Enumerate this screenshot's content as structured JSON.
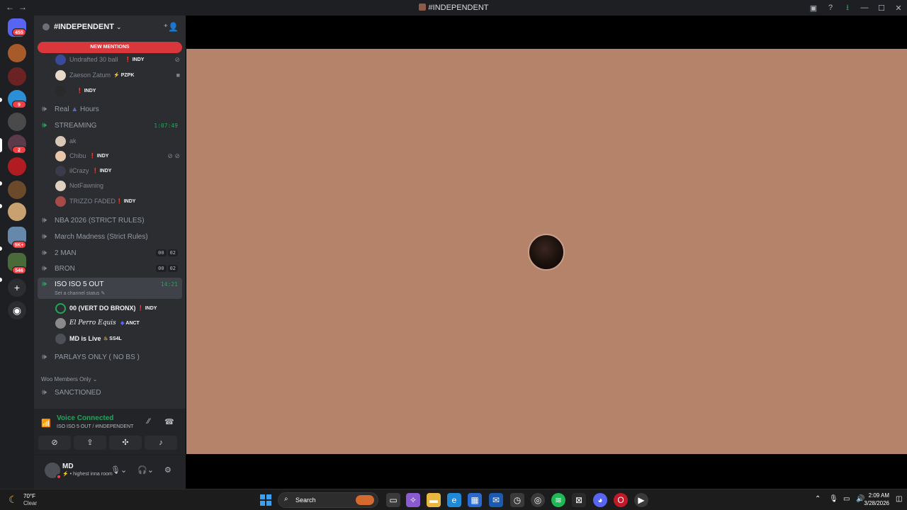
{
  "window": {
    "title": "#INDEPENDENT",
    "nav_back": "←",
    "nav_forward": "→",
    "icons": [
      "screen-icon",
      "help-icon",
      "download-icon"
    ]
  },
  "servers": {
    "home_badge": "455",
    "badges": [
      {
        "id": "s4",
        "count": "9"
      },
      {
        "id": "s6",
        "count": "2"
      },
      {
        "id": "s11",
        "count": "9K+"
      },
      {
        "id": "s12",
        "count": "546"
      }
    ]
  },
  "guild": {
    "name": "#INDEPENDENT",
    "new_mentions": "NEW MENTIONS"
  },
  "top_users": [
    {
      "name": "Undrafted 30 ball",
      "tag": "INDY"
    },
    {
      "name": "Zaeson Zatum",
      "tag": "PZPK"
    },
    {
      "name": "",
      "tag": "INDY"
    }
  ],
  "channels": {
    "real_hours": {
      "name": "Real",
      "name2": "Hours"
    },
    "streaming": {
      "name": "STREAMING",
      "timer": "1:07:49"
    },
    "streaming_users": [
      {
        "name": "ak",
        "tag": ""
      },
      {
        "name": "Chibu",
        "tag": "INDY"
      },
      {
        "name": "ilCrazy",
        "tag": "INDY"
      },
      {
        "name": "NotFawning",
        "tag": ""
      },
      {
        "name": "TRIZZO FADED",
        "tag": "INDY"
      }
    ],
    "nba": {
      "name": "NBA 2026 (STRICT RULES)"
    },
    "march": {
      "name": "March Madness (Strict Rules)"
    },
    "two_man": {
      "name": "2 MAN",
      "c1": "00",
      "c2": "02"
    },
    "bron": {
      "name": "BRON",
      "c1": "00",
      "c2": "02"
    },
    "iso": {
      "name": "ISO ISO 5 OUT",
      "timer": "14:21",
      "status": "Set a channel status"
    },
    "iso_users": [
      {
        "name": "00 (VERT DO BRONX)",
        "tag": "INDY"
      },
      {
        "name": "El Perro Equis",
        "tag": "ANCT"
      },
      {
        "name": "MD is Live",
        "tag": "SS4L"
      }
    ],
    "parlays": {
      "name": "PARLAYS ONLY ( NO BS )"
    },
    "category": "Woo Members Only",
    "sanctioned": {
      "name": "SANCTIONED"
    }
  },
  "voice": {
    "label": "Voice Connected",
    "sub": "ISO ISO 5 OUT / #INDEPENDENT"
  },
  "user": {
    "name": "MD",
    "status": "highest inna room"
  },
  "taskbar": {
    "temp": "70°F",
    "weather": "Clear",
    "search": "Search",
    "time": "2:09 AM",
    "date": "3/28/2026"
  },
  "colors": {
    "accent_green": "#23a55a",
    "mention_red": "#da373c",
    "stream_bg": "#b5826a"
  }
}
